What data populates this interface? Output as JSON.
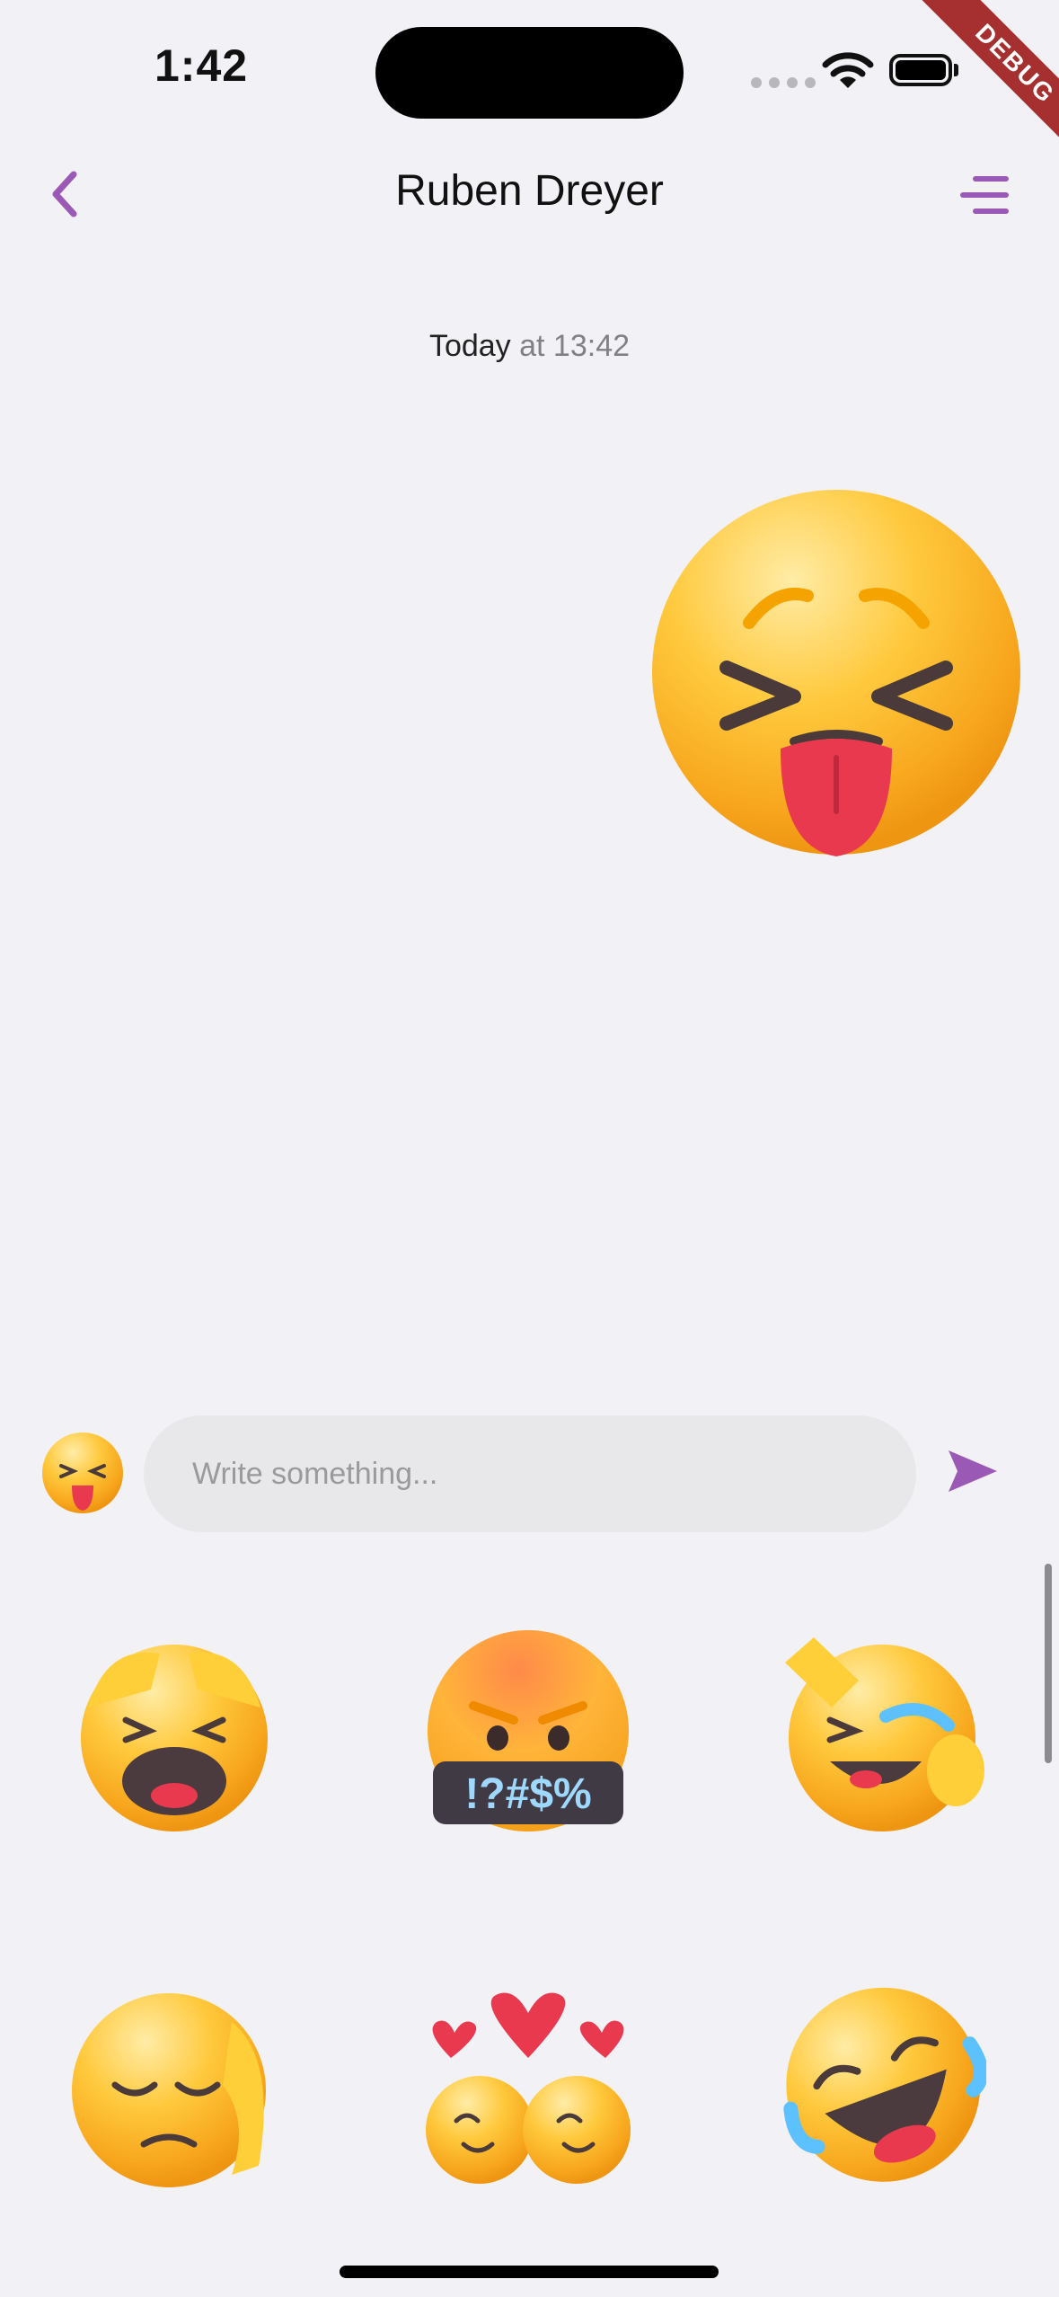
{
  "status_bar": {
    "time": "1:42",
    "debug_banner": "DEBUG"
  },
  "header": {
    "title": "Ruben Dreyer",
    "back_icon": "chevron-left-icon",
    "menu_icon": "menu-icon"
  },
  "chat": {
    "timestamp_day": "Today",
    "timestamp_time": " at 13:42",
    "message_sticker": "tongue-out-squinting-face-sticker"
  },
  "composer": {
    "placeholder": "Write something...",
    "sticker_icon": "sticker-picker-icon",
    "send_icon": "send-icon"
  },
  "sticker_grid": {
    "stickers": [
      "yawning-hands-on-head-sticker",
      "cursing-face-sticker",
      "laughing-salute-sticker",
      "facepalm-pensive-sticker",
      "hugging-faces-with-heart-sticker",
      "rolling-laughing-tears-sticker"
    ]
  },
  "colors": {
    "accent": "#9b59b6",
    "background": "#f2f1f6",
    "input_bg": "#e8e8ea"
  }
}
